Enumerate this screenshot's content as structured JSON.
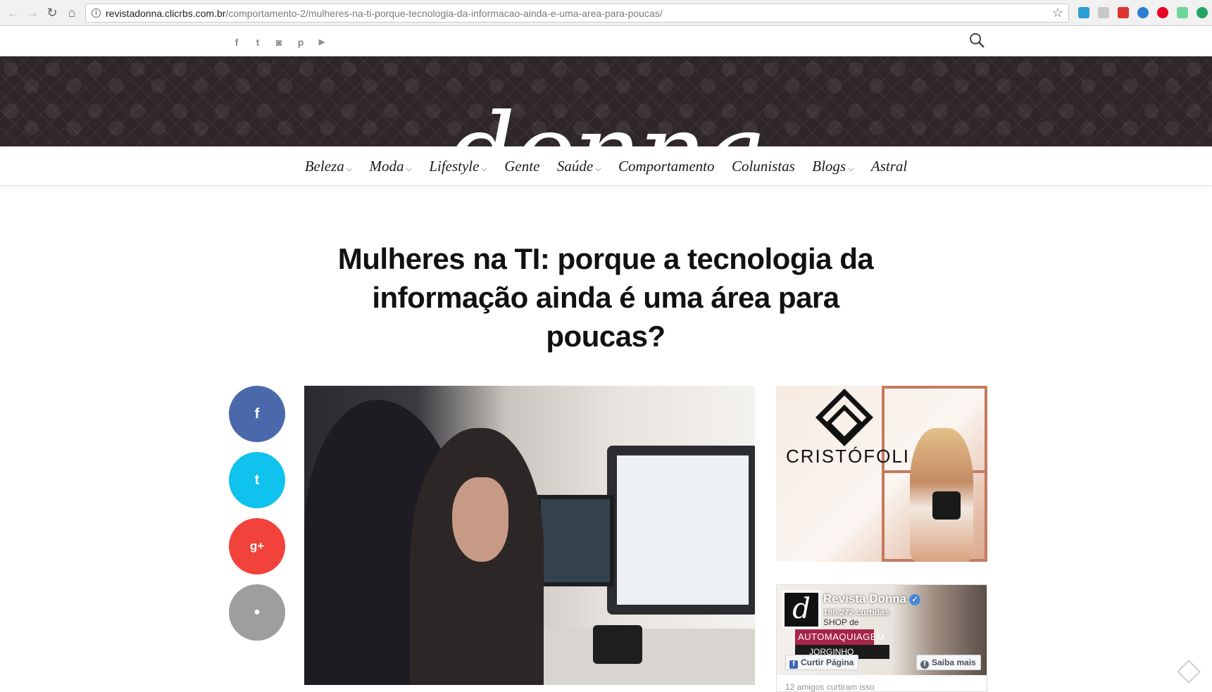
{
  "browser": {
    "url_host": "revistadonna.clicrbs.com.br",
    "url_path": "/comportamento-2/mulheres-na-ti-porque-tecnologia-da-informacao-ainda-e-uma-area-para-poucas/",
    "icons": [
      "back-icon",
      "forward-icon",
      "reload-icon",
      "home-icon",
      "info-icon",
      "bookmark-star-icon"
    ]
  },
  "social": {
    "icons": [
      "facebook-icon",
      "twitter-icon",
      "instagram-icon",
      "pinterest-icon",
      "youtube-icon"
    ],
    "glyphs": [
      "f",
      "t",
      "◙",
      "p",
      "▶"
    ]
  },
  "header": {
    "logo": "donna"
  },
  "nav": {
    "items": [
      {
        "label": "Beleza",
        "has_dropdown": true
      },
      {
        "label": "Moda",
        "has_dropdown": true
      },
      {
        "label": "Lifestyle",
        "has_dropdown": true
      },
      {
        "label": "Gente",
        "has_dropdown": false
      },
      {
        "label": "Saúde",
        "has_dropdown": true
      },
      {
        "label": "Comportamento",
        "has_dropdown": false
      },
      {
        "label": "Colunistas",
        "has_dropdown": false
      },
      {
        "label": "Blogs",
        "has_dropdown": true
      },
      {
        "label": "Astral",
        "has_dropdown": false
      }
    ]
  },
  "article": {
    "title_line1": "Mulheres na TI: porque a tecnologia da",
    "title_line2": "informação ainda é uma área para",
    "title_line3": "poucas?"
  },
  "share": {
    "facebook": "f",
    "twitter": "t",
    "google_plus": "g+",
    "comment": "●",
    "colors": {
      "facebook": "#4a68aa",
      "twitter": "#10c2ee",
      "google_plus": "#f1433b",
      "comment": "#9e9e9e"
    }
  },
  "ad": {
    "brand": "CRISTÓFOLI"
  },
  "fb_widget": {
    "page_name": "Revista Donna",
    "likes": "186.272 curtidas",
    "shop_line": "SHOP de",
    "banner_line1": "AUTOMAQUIAGEM",
    "banner_line2": "JORGINHO GOULART",
    "like_button": "Curtir Página",
    "learn_more_button": "Saiba mais",
    "friends": "12 amigos curtiram isso"
  },
  "colors": {
    "banner_bg": "#2f2629",
    "brand_pink": "#a6244a"
  }
}
